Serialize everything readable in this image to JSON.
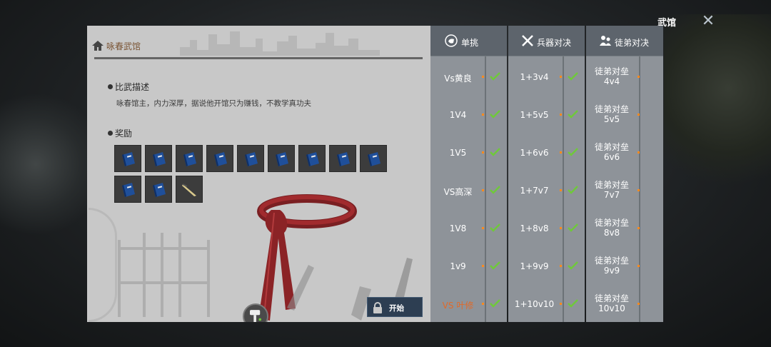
{
  "header": {
    "title": "武馆",
    "close_icon": "close-icon"
  },
  "panel": {
    "title": "咏春武馆",
    "desc_title": "比武描述",
    "desc_text": "咏春馆主，内力深厚，据说他开馆只为赚钱，不教学真功夫",
    "reward_title": "奖励",
    "rewards": [
      "book-icon",
      "book-icon",
      "book-icon",
      "book-icon",
      "book-icon",
      "book-icon",
      "book-icon",
      "book-icon",
      "book-icon",
      "book-icon",
      "book-icon",
      "dart-icon"
    ],
    "start_label": "开始"
  },
  "tabs": [
    {
      "label": "单挑",
      "icon": "fist-icon"
    },
    {
      "label": "兵器对决",
      "icon": "crossed-swords-icon"
    },
    {
      "label": "徒弟对决",
      "icon": "disciples-icon"
    }
  ],
  "single": [
    {
      "label": "Vs黄良",
      "highlight": false
    },
    {
      "label": "1V4",
      "highlight": false
    },
    {
      "label": "1V5",
      "highlight": false
    },
    {
      "label": "VS高深",
      "highlight": false
    },
    {
      "label": "1V8",
      "highlight": false
    },
    {
      "label": "1v9",
      "highlight": false
    },
    {
      "label": "VS 叶修",
      "highlight": true
    }
  ],
  "weapons": [
    {
      "label": "1+3v4"
    },
    {
      "label": "1+5v5"
    },
    {
      "label": "1+6v6"
    },
    {
      "label": "1+7v7"
    },
    {
      "label": "1+8v8"
    },
    {
      "label": "1+9v9"
    },
    {
      "label": "1+10v10"
    }
  ],
  "disciples": [
    {
      "label": "徒弟对垒4v4"
    },
    {
      "label": "徒弟对垒5v5"
    },
    {
      "label": "徒弟对垒6v6"
    },
    {
      "label": "徒弟对垒7v7"
    },
    {
      "label": "徒弟对垒8v8"
    },
    {
      "label": "徒弟对垒9v9"
    },
    {
      "label": "徒弟对垒10v10"
    }
  ],
  "colors": {
    "check": "#6fc93a",
    "accent_orange": "#ff8a1c",
    "highlight_text": "#e06a2a"
  }
}
